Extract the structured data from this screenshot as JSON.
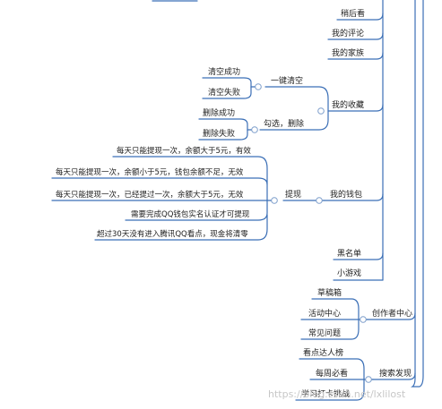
{
  "colors": {
    "line": "#3b6fb6",
    "text": "#222222",
    "watermark": "#c7c7c7"
  },
  "mindmap": {
    "right_items": {
      "later": "稍后看",
      "comments": "我的评论",
      "family": "我的家族",
      "collection": "我的收藏",
      "wallet": "我的钱包",
      "blacklist": "黑名单",
      "games": "小游戏",
      "creator_center": "创作者中心",
      "search_discover": "搜索发现"
    },
    "collection_children": {
      "clear_all": "一键清空",
      "select_delete": "勾选，删除"
    },
    "clear_results": {
      "success": "清空成功",
      "fail": "清空失败"
    },
    "delete_results": {
      "success": "删除成功",
      "fail": "删除失败"
    },
    "wallet_child": "提现",
    "withdraw_rules": [
      "每天只能提现一次，余额大于5元，有效",
      "每天只能提现一次，余额小于5元，钱包余额不足，无效",
      "每天只能提现一次，已经提过一次，余额大于5元，无效",
      "需要完成QQ钱包实名认证才可提现",
      "超过30天没有进入腾讯QQ看点，现金将清零"
    ],
    "creator_children": [
      "草稿箱",
      "活动中心",
      "常见问题"
    ],
    "search_children": [
      "看点达人榜",
      "每周必看",
      "学习打卡挑战"
    ]
  },
  "watermark": "https://blog.csdn.net/lxlilost"
}
